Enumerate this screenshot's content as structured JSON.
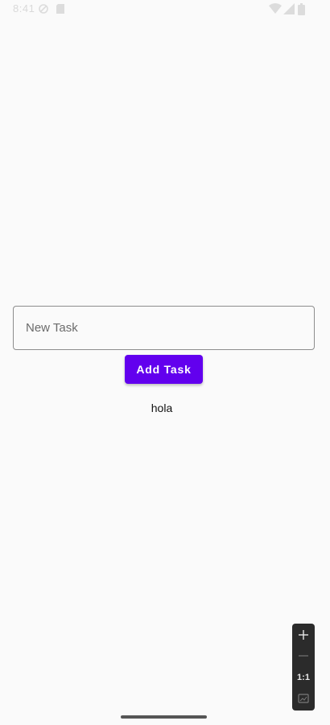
{
  "status_bar": {
    "time": "8:41",
    "icons": [
      "location-icon",
      "sd-card-icon",
      "wifi-icon",
      "signal-icon",
      "battery-icon"
    ]
  },
  "task_input": {
    "placeholder": "New Task",
    "value": ""
  },
  "add_button": {
    "label": "Add Task"
  },
  "tasks": [
    {
      "label": "hola"
    }
  ],
  "zoom_controls": {
    "zoom_in_icon": "plus-icon",
    "zoom_out_icon": "minus-icon",
    "reset_label": "1:1",
    "fit_icon": "fit-screen-icon"
  },
  "colors": {
    "accent": "#6200ee",
    "background": "#fafafa",
    "text": "#111111"
  }
}
